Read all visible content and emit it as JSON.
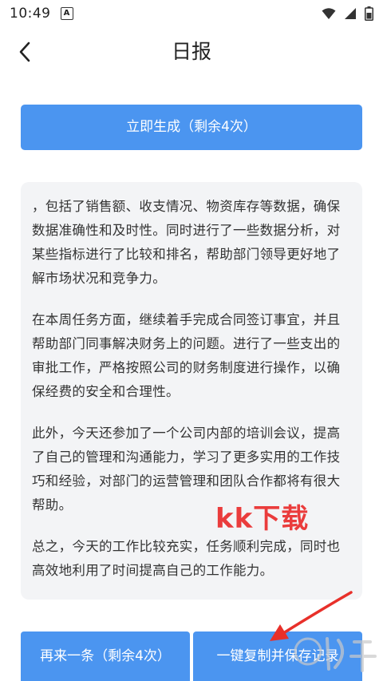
{
  "status_bar": {
    "time": "10:49",
    "notification_letter": "A",
    "icons": [
      "wifi-icon",
      "signal-icon",
      "battery-icon"
    ]
  },
  "header": {
    "back_icon": "chevron-left-icon",
    "title": "日报"
  },
  "generate_button": {
    "label": "立即生成（剩余4次）"
  },
  "report": {
    "paragraphs": [
      "，包括了销售额、收支情况、物资库存等数据，确保数据准确性和及时性。同时进行了一些数据分析，对某些指标进行了比较和排名，帮助部门领导更好地了解市场状况和竞争力。",
      "在本周任务方面，继续着手完成合同签订事宜，并且帮助部门同事解决财务上的问题。进行了一些支出的审批工作，严格按照公司的财务制度进行操作，以确保经费的安全和合理性。",
      "此外，今天还参加了一个公司内部的培训会议，提高了自己的管理和沟通能力，学习了更多实用的工作技巧和经验，对部门的运营管理和团队合作都将有很大帮助。",
      "总之，今天的工作比较充实，任务顺利完成，同时也高效地利用了时间提高自己的工作能力。"
    ]
  },
  "watermark": {
    "text": "kk下载"
  },
  "bottom_bar": {
    "retry_label": "再来一条（剩余4次）",
    "copy_save_label": "一键复制并保存记录"
  },
  "colors": {
    "primary": "#4b95f0",
    "card_bg": "#f3f4f6",
    "annotation_red": "#e8302a"
  }
}
